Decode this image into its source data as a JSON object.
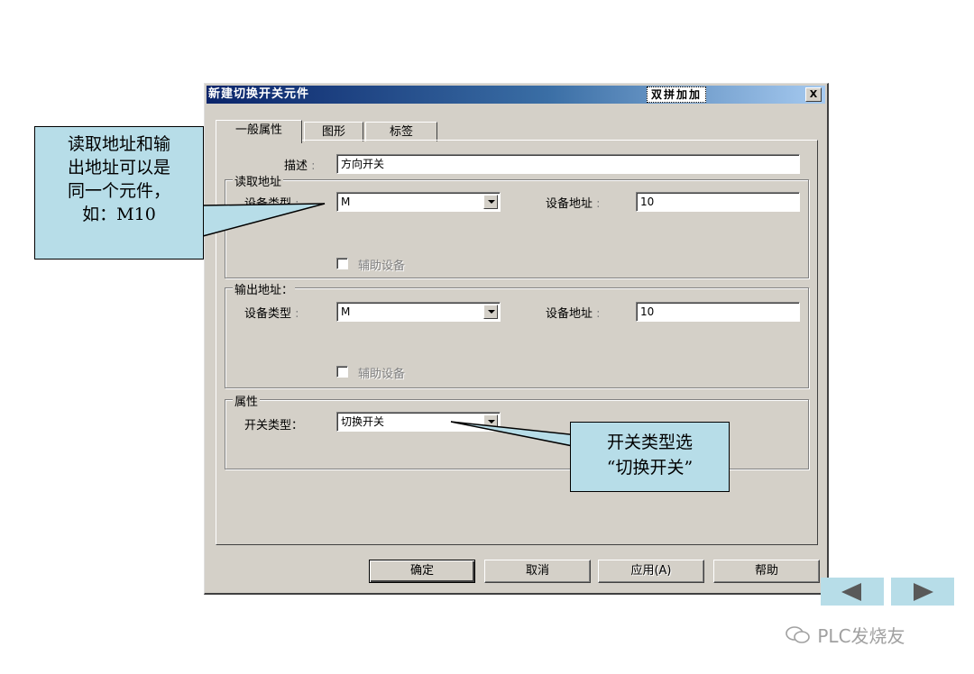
{
  "window": {
    "title": "新建切换开关元件",
    "ime_status": "双拼加加",
    "close_label": "X"
  },
  "tabs": [
    {
      "label": "一般属性",
      "active": true
    },
    {
      "label": "图形",
      "active": false
    },
    {
      "label": "标签",
      "active": false
    }
  ],
  "general": {
    "description_label": "描述",
    "description_value": "方向开关"
  },
  "read_address": {
    "legend": "读取地址",
    "device_type_label": "设备类型",
    "device_type_value": "M",
    "device_address_label": "设备地址",
    "device_address_value": "10",
    "aux_device_label": "辅助设备"
  },
  "output_address": {
    "legend": "输出地址：",
    "device_type_label": "设备类型",
    "device_type_value": "M",
    "device_address_label": "设备地址",
    "device_address_value": "10",
    "aux_device_label": "辅助设备"
  },
  "properties": {
    "legend": "属性",
    "switch_type_label": "开关类型：",
    "switch_type_value": "切换开关"
  },
  "buttons": {
    "ok": "确定",
    "cancel": "取消",
    "apply": "应用(A)",
    "help": "帮助"
  },
  "callouts": {
    "address_note_lines": [
      "读取地址和输",
      "出地址可以是",
      "同一个元件，",
      "如：M10"
    ],
    "switch_note_lines": [
      "开关类型选",
      "“切换开关”"
    ]
  },
  "nav": {
    "prev_icon": "triangle-left-icon",
    "next_icon": "triangle-right-icon"
  },
  "watermark": "PLC发烧友",
  "colors": {
    "callout_fill": "#b7dde8",
    "titlebar_start": "#0a246a",
    "titlebar_end": "#a6caf0",
    "dialog_face": "#d4d0c8"
  }
}
